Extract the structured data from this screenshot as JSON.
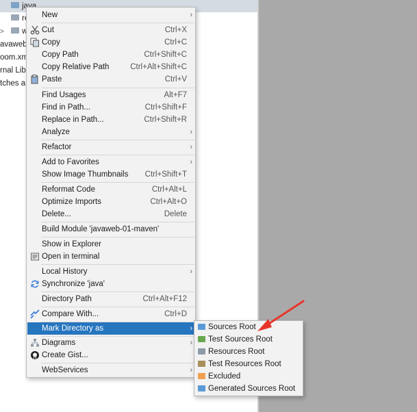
{
  "tree": {
    "rows": [
      {
        "label": "java",
        "selected": true
      },
      {
        "label": "re"
      },
      {
        "label": "w"
      },
      {
        "label": "avaweb"
      },
      {
        "label": "oom.xm"
      },
      {
        "label": "rnal Lib"
      },
      {
        "label": "tches ar"
      }
    ],
    "chevron": ">"
  },
  "context_menu": {
    "items": [
      {
        "label": "New",
        "shortcut": "",
        "submenu": true
      },
      {
        "label": "Cut",
        "shortcut": "Ctrl+X",
        "icon": "scissors-icon"
      },
      {
        "label": "Copy",
        "shortcut": "Ctrl+C",
        "icon": "copy-icon"
      },
      {
        "label": "Copy Path",
        "shortcut": "Ctrl+Shift+C"
      },
      {
        "label": "Copy Relative Path",
        "shortcut": "Ctrl+Alt+Shift+C"
      },
      {
        "label": "Paste",
        "shortcut": "Ctrl+V",
        "icon": "paste-icon"
      },
      {
        "label": "Find Usages",
        "shortcut": "Alt+F7"
      },
      {
        "label": "Find in Path...",
        "shortcut": "Ctrl+Shift+F"
      },
      {
        "label": "Replace in Path...",
        "shortcut": "Ctrl+Shift+R"
      },
      {
        "label": "Analyze",
        "shortcut": "",
        "submenu": true
      },
      {
        "label": "Refactor",
        "shortcut": "",
        "submenu": true
      },
      {
        "label": "Add to Favorites",
        "shortcut": "",
        "submenu": true
      },
      {
        "label": "Show Image Thumbnails",
        "shortcut": "Ctrl+Shift+T"
      },
      {
        "label": "Reformat Code",
        "shortcut": "Ctrl+Alt+L"
      },
      {
        "label": "Optimize Imports",
        "shortcut": "Ctrl+Alt+O"
      },
      {
        "label": "Delete...",
        "shortcut": "Delete"
      },
      {
        "label": "Build Module 'javaweb-01-maven'",
        "shortcut": ""
      },
      {
        "label": "Show in Explorer",
        "shortcut": ""
      },
      {
        "label": "Open in terminal",
        "shortcut": "",
        "icon": "terminal-icon"
      },
      {
        "label": "Local History",
        "shortcut": "",
        "submenu": true
      },
      {
        "label": "Synchronize 'java'",
        "shortcut": "",
        "icon": "sync-icon"
      },
      {
        "label": "Directory Path",
        "shortcut": "Ctrl+Alt+F12"
      },
      {
        "label": "Compare With...",
        "shortcut": "Ctrl+D",
        "icon": "compare-icon"
      },
      {
        "label": "Mark Directory as",
        "shortcut": "",
        "submenu": true,
        "highlighted": true
      },
      {
        "label": "Diagrams",
        "shortcut": "",
        "submenu": true,
        "icon": "diagram-icon"
      },
      {
        "label": "Create Gist...",
        "shortcut": "",
        "icon": "github-icon"
      },
      {
        "label": "WebServices",
        "shortcut": "",
        "submenu": true
      }
    ],
    "arrow_glyph": "›"
  },
  "mark_submenu": {
    "items": [
      {
        "label": "Sources Root",
        "color": "#5b9bd5"
      },
      {
        "label": "Test Sources Root",
        "color": "#6aa84f"
      },
      {
        "label": "Resources Root",
        "color": "#8e9aa6"
      },
      {
        "label": "Test Resources Root",
        "color": "#a88f5c"
      },
      {
        "label": "Excluded",
        "color": "#f0a050"
      },
      {
        "label": "Generated Sources Root",
        "color": "#5b9bd5"
      }
    ]
  },
  "colors": {
    "highlight": "#2675bf",
    "annotation_arrow": "#e8352b"
  }
}
